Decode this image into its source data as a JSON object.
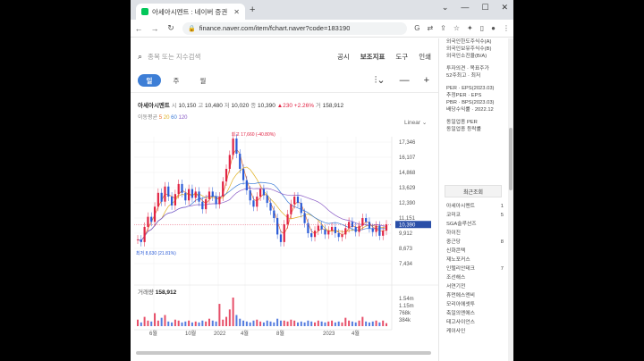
{
  "browser": {
    "tab_title": "아세아시멘트 : 네이버 증권",
    "url": "finance.naver.com/item/fchart.naver?code=183190",
    "new_tab": "+",
    "tab_close": "✕"
  },
  "search": {
    "placeholder": "종목 또는 지수검색"
  },
  "topmenu": [
    "공시",
    "보조지표",
    "도구",
    "인쇄"
  ],
  "periods": [
    "일",
    "주",
    "월"
  ],
  "stock": {
    "name": "아세아시멘트",
    "open_label": "시",
    "open": "10,150",
    "high_label": "고",
    "high": "10,480",
    "low_label": "저",
    "low": "10,020",
    "close_label": "종",
    "close": "10,390",
    "change": "▲230",
    "change_pct": "+2.26%",
    "volume_label": "거",
    "volume": "158,912"
  },
  "ma": {
    "label": "이동평균",
    "ma5": "5",
    "ma20": "20",
    "ma60": "60",
    "ma120": "120"
  },
  "scale_type": "Linear",
  "chart_data": {
    "type": "line",
    "y_ticks": [
      "17,346",
      "16,107",
      "14,868",
      "13,629",
      "12,390",
      "11,151",
      "9,912",
      "8,673",
      "7,434"
    ],
    "ylim": [
      7434,
      17346
    ],
    "x_ticks": [
      "6월",
      "10월",
      "2022",
      "4월",
      "8월",
      "2023",
      "4월"
    ],
    "current_price_label": "10,390",
    "high_marker": "최고 17,660 (-40.80%)",
    "low_marker": "최저 8,630 (21.81%)",
    "volume_title": "거래량",
    "volume_value": "158,912",
    "volume_ticks": [
      "1.54m",
      "1.15m",
      "768k",
      "384k"
    ],
    "price_series": [
      9.2,
      9.0,
      10.2,
      11.0,
      10.6,
      11.8,
      12.9,
      12.2,
      13.4,
      12.6,
      11.9,
      12.8,
      13.6,
      12.9,
      12.3,
      13.2,
      12.5,
      13.0,
      12.2,
      11.6,
      12.4,
      13.0,
      12.6,
      12.0,
      12.6,
      13.8,
      14.8,
      15.9,
      17.2,
      16.0,
      14.8,
      13.9,
      13.1,
      12.3,
      11.8,
      12.6,
      13.2,
      12.7,
      12.1,
      11.5,
      10.9,
      9.6,
      9.0,
      10.4,
      11.2,
      12.0,
      12.6,
      12.1,
      11.3,
      10.5,
      9.7,
      9.4,
      9.9,
      10.3,
      10.0,
      9.6,
      9.9,
      10.2,
      9.7,
      9.4,
      9.6,
      10.1,
      10.6,
      10.2,
      9.8,
      10.3,
      10.9,
      10.6,
      10.1,
      9.8,
      10.3,
      9.5,
      9.9,
      10.39
    ],
    "volume_series": [
      0.35,
      0.2,
      0.5,
      0.3,
      0.25,
      0.7,
      0.3,
      0.45,
      0.6,
      0.25,
      0.2,
      0.35,
      0.3,
      0.2,
      0.25,
      0.3,
      0.2,
      0.25,
      0.2,
      0.3,
      0.25,
      0.4,
      0.3,
      0.25,
      1.2,
      0.35,
      0.5,
      0.9,
      1.54,
      0.6,
      0.4,
      0.3,
      0.25,
      0.2,
      0.3,
      0.35,
      0.25,
      0.2,
      0.3,
      0.25,
      0.2,
      0.4,
      0.3,
      0.3,
      0.25,
      0.35,
      0.3,
      0.2,
      0.25,
      0.2,
      0.3,
      0.25,
      0.2,
      0.3,
      0.25,
      0.2,
      0.25,
      0.3,
      0.2,
      0.25,
      0.2,
      0.45,
      0.3,
      0.25,
      0.2,
      0.3,
      0.5,
      0.25,
      0.2,
      0.25,
      0.3,
      0.2,
      0.3,
      0.16
    ],
    "colors": {
      "price": "#222222",
      "ma5": "#e96d2a",
      "ma20": "#e0b020",
      "ma60": "#3b7bd6",
      "ma120": "#8a5cc6",
      "up": "#e12343",
      "down": "#2a5bd7",
      "current_badge": "#2a4fa8"
    }
  },
  "side": {
    "info": [
      "외국인한도주식수(A)",
      "외국인보유주식수(B)",
      "외국인소진율(B/A)",
      "",
      "투자의견 · 목표주가",
      "52주최고 · 최저",
      "",
      "PER · EPS(2023.03)",
      "추정PER · EPS",
      "PBR · BPS(2023.03)",
      "배당수익률 · 2022.12",
      "",
      "동일업종 PER",
      "동일업종 등락률"
    ],
    "recent_title": "최근조회",
    "recent": [
      {
        "name": "아세아시멘트",
        "val": "1"
      },
      {
        "name": "코미코",
        "val": "5"
      },
      {
        "name": "SGA솔루션즈",
        "val": ""
      },
      {
        "name": "하이진",
        "val": ""
      },
      {
        "name": "중근당",
        "val": "8"
      },
      {
        "name": "",
        "val": ""
      },
      {
        "name": "신화콘텍",
        "val": ""
      },
      {
        "name": "제노포커스",
        "val": ""
      },
      {
        "name": "인텔리안테크",
        "val": "7"
      },
      {
        "name": "조선해스",
        "val": ""
      },
      {
        "name": "서연기전",
        "val": ""
      },
      {
        "name": "",
        "val": ""
      },
      {
        "name": "휴먼에스엔비",
        "val": ""
      },
      {
        "name": "모리아에셋투",
        "val": ""
      },
      {
        "name": "축일의엔에스",
        "val": ""
      },
      {
        "name": "테고사이언스",
        "val": ""
      },
      {
        "name": "케이사인",
        "val": ""
      }
    ]
  }
}
